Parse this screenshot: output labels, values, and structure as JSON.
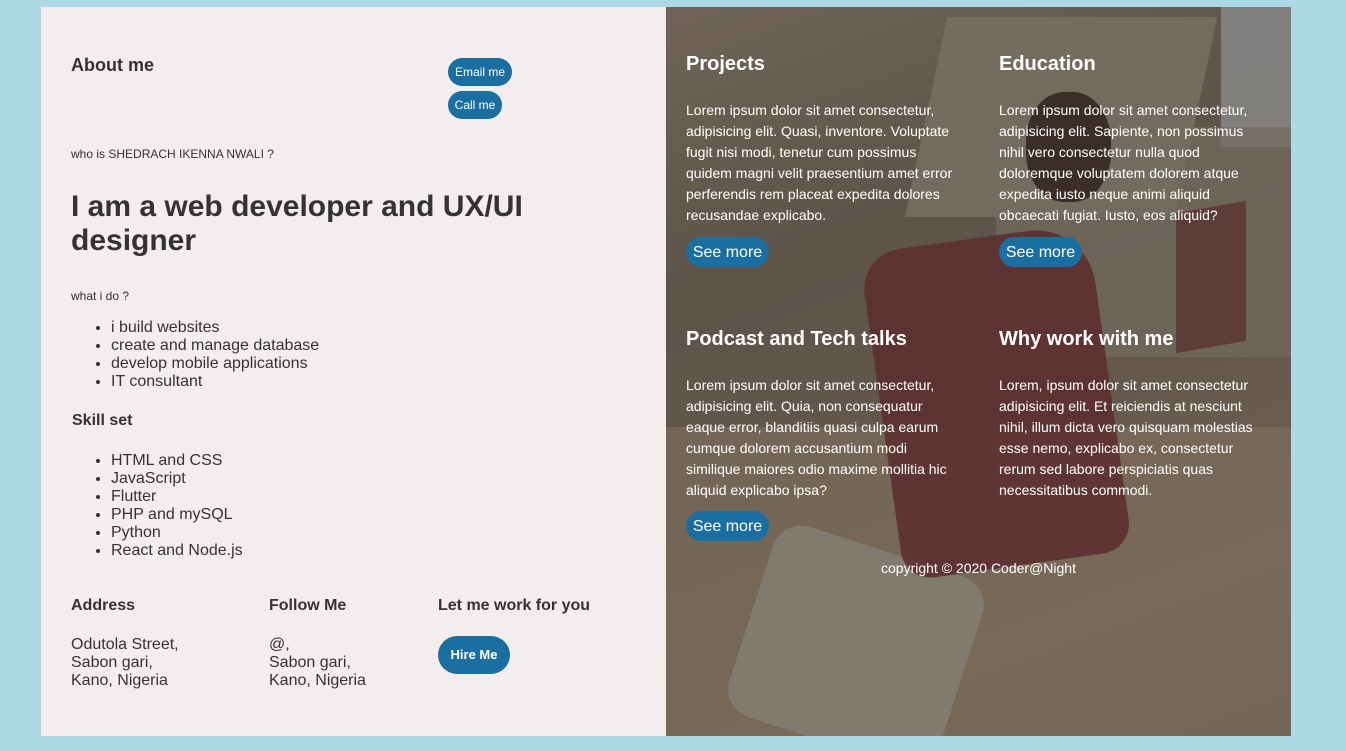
{
  "about": {
    "title": "About me",
    "email_label": "Email me",
    "call_label": "Call me",
    "who": "who is SHEDRACH IKENNA NWALI ?",
    "headline": "I am a web developer and UX/UI designer",
    "what_label": "what i do ?",
    "what_items": [
      "i build websites",
      "create and manage database",
      "develop mobile applications",
      "IT consultant"
    ],
    "skill_title": "Skill set",
    "skills": [
      "HTML and CSS",
      "JavaScript",
      "Flutter",
      "PHP and mySQL",
      "Python",
      "React and Node.js"
    ]
  },
  "footer_left": {
    "address_title": "Address",
    "address_lines": [
      "Odutola Street,",
      "Sabon gari,",
      "Kano, Nigeria"
    ],
    "follow_title": "Follow Me",
    "follow_lines": [
      "@,",
      "Sabon gari,",
      "Kano, Nigeria"
    ],
    "work_title": "Let me work for you",
    "hire_label": "Hire Me"
  },
  "cards": [
    {
      "title": "Projects",
      "text": "Lorem ipsum dolor sit amet consectetur, adipisicing elit. Quasi, inventore. Voluptate fugit nisi modi, tenetur cum possimus quidem magni velit praesentium amet error perferendis rem placeat expedita dolores recusandae explicabo.",
      "button": "See more"
    },
    {
      "title": "Education",
      "text": "Lorem ipsum dolor sit amet consectetur, adipisicing elit. Sapiente, non possimus nihil vero consectetur nulla quod doloremque voluptatem dolorem atque expedita iusto neque animi aliquid obcaecati fugiat. Iusto, eos aliquid?",
      "button": "See more"
    },
    {
      "title": "Podcast and Tech talks",
      "text": "Lorem ipsum dolor sit amet consectetur, adipisicing elit. Quia, non consequatur eaque error, blanditiis quasi culpa earum cumque dolorem accusantium modi similique maiores odio maxime mollitia hic aliquid explicabo ipsa?",
      "button": "See more"
    },
    {
      "title": "Why work with me",
      "text": "Lorem, ipsum dolor sit amet consectetur adipisicing elit. Et reiciendis at nesciunt nihil, illum dicta vero quisquam molestias esse nemo, explicabo ex, consectetur rerum sed labore perspiciatis quas necessitatibus commodi.",
      "button": null
    }
  ],
  "copyright": "copyright © 2020 Coder@Night",
  "colors": {
    "page_bg": "#add8e6",
    "panel_bg": "#f3eded",
    "accent": "#1b6fa0"
  }
}
